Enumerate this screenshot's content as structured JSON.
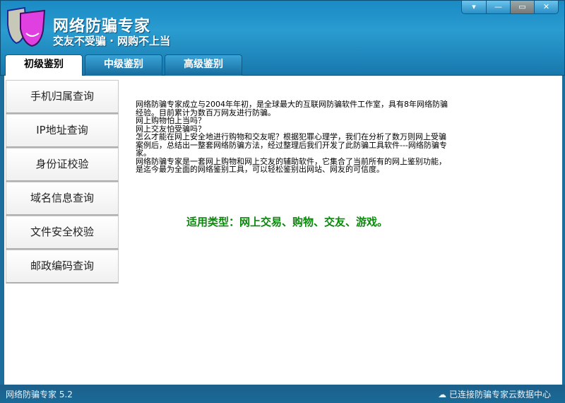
{
  "app": {
    "title": "网络防骗专家",
    "slogan": "交友不受骗 · 网购不上当"
  },
  "window_buttons": {
    "menu": "▾",
    "minimize": "—",
    "maximize": "▭",
    "close": "✕"
  },
  "tabs": [
    {
      "label": "初级鉴别",
      "active": true
    },
    {
      "label": "中级鉴别"
    },
    {
      "label": "高级鉴别"
    }
  ],
  "sidebar": {
    "items": [
      {
        "label": "手机归属查询"
      },
      {
        "label": "IP地址查询"
      },
      {
        "label": "身份证校验"
      },
      {
        "label": "域名信息查询"
      },
      {
        "label": "文件安全校验"
      },
      {
        "label": "邮政编码查询"
      }
    ]
  },
  "intro": {
    "lines": [
      "网络防骗专家成立与2004年年初，是全球最大的互联网防骗软件工作室，具有8年网络防骗经验。目前累计为数百万网友进行防骗。",
      "网上购物怕上当吗？",
      "网上交友怕受骗吗？",
      "怎么才能在网上安全地进行购物和交友呢？根据犯罪心理学，我们在分析了数万则网上受骗案例后，总结出一整套网络防骗方法，经过整理后我们开发了此防骗工具软件---网络防骗专家。",
      "网络防骗专家是一套网上购物和网上交友的辅助软件，它集合了当前所有的网上鉴别功能，是迄今最为全面的网络鉴别工具，可以轻松鉴别出网站、网友的可信度。"
    ]
  },
  "types": "适用类型：网上交易、购物、交友、游戏。",
  "status": {
    "version": "网络防骗专家 5.2",
    "connection": "已连接防骗专家云数据中心"
  }
}
